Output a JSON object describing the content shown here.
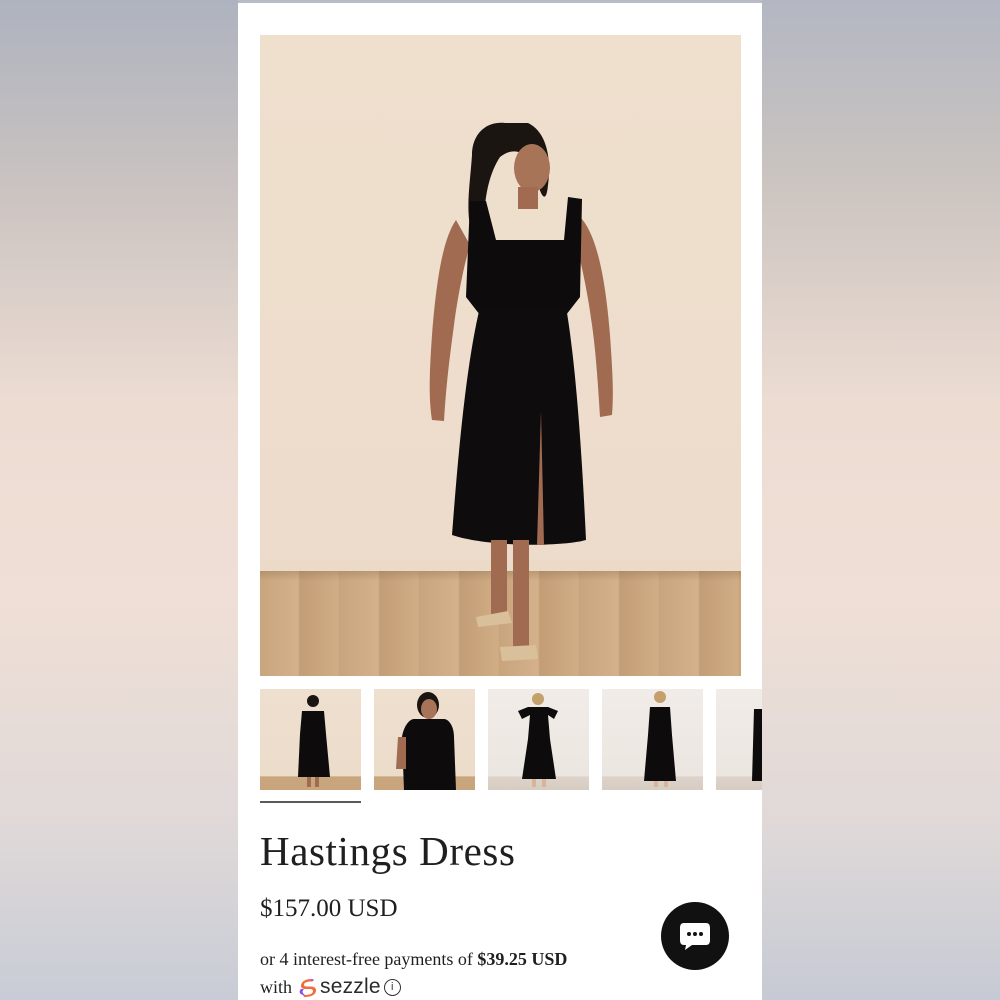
{
  "product": {
    "title": "Hastings Dress",
    "price": "$157.00 USD",
    "installments_prefix": "or 4 interest-free payments of ",
    "installments_amount": "$39.25 USD",
    "installments_with": "with",
    "payment_provider": "sezzle",
    "info_icon_glyph": "i"
  },
  "gallery": {
    "main_image": "model in black midi dress with slit, front view",
    "thumbnails": [
      {
        "label": "front full-length",
        "selected": true
      },
      {
        "label": "close-up front",
        "selected": false
      },
      {
        "label": "model front, arms on hips",
        "selected": false
      },
      {
        "label": "back view",
        "selected": false
      },
      {
        "label": "partial",
        "selected": false
      }
    ]
  },
  "chat": {
    "icon": "chat-bubble-icon"
  },
  "colors": {
    "text": "#1f1f1f",
    "chat_button": "#111111",
    "sezzle_orange": "#f26b3a",
    "sezzle_purple": "#8a4cf0"
  }
}
